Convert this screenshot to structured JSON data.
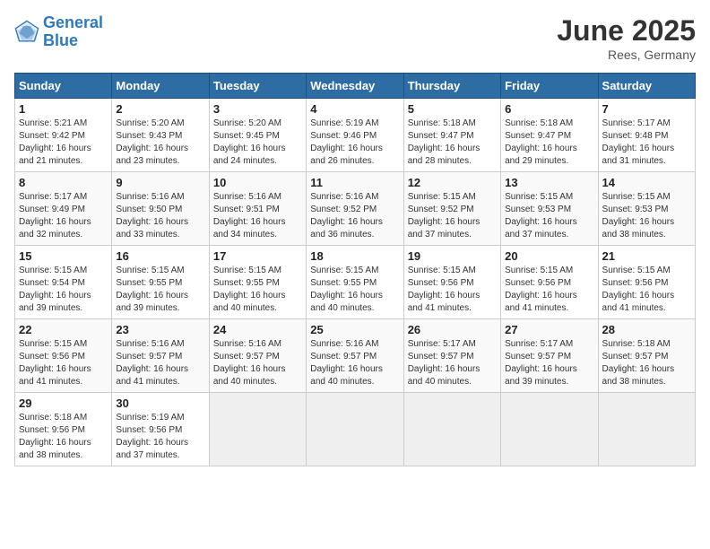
{
  "header": {
    "logo_line1": "General",
    "logo_line2": "Blue",
    "month": "June 2025",
    "location": "Rees, Germany"
  },
  "weekdays": [
    "Sunday",
    "Monday",
    "Tuesday",
    "Wednesday",
    "Thursday",
    "Friday",
    "Saturday"
  ],
  "weeks": [
    [
      {
        "day": "1",
        "sunrise": "Sunrise: 5:21 AM",
        "sunset": "Sunset: 9:42 PM",
        "daylight": "Daylight: 16 hours and 21 minutes."
      },
      {
        "day": "2",
        "sunrise": "Sunrise: 5:20 AM",
        "sunset": "Sunset: 9:43 PM",
        "daylight": "Daylight: 16 hours and 23 minutes."
      },
      {
        "day": "3",
        "sunrise": "Sunrise: 5:20 AM",
        "sunset": "Sunset: 9:45 PM",
        "daylight": "Daylight: 16 hours and 24 minutes."
      },
      {
        "day": "4",
        "sunrise": "Sunrise: 5:19 AM",
        "sunset": "Sunset: 9:46 PM",
        "daylight": "Daylight: 16 hours and 26 minutes."
      },
      {
        "day": "5",
        "sunrise": "Sunrise: 5:18 AM",
        "sunset": "Sunset: 9:47 PM",
        "daylight": "Daylight: 16 hours and 28 minutes."
      },
      {
        "day": "6",
        "sunrise": "Sunrise: 5:18 AM",
        "sunset": "Sunset: 9:47 PM",
        "daylight": "Daylight: 16 hours and 29 minutes."
      },
      {
        "day": "7",
        "sunrise": "Sunrise: 5:17 AM",
        "sunset": "Sunset: 9:48 PM",
        "daylight": "Daylight: 16 hours and 31 minutes."
      }
    ],
    [
      {
        "day": "8",
        "sunrise": "Sunrise: 5:17 AM",
        "sunset": "Sunset: 9:49 PM",
        "daylight": "Daylight: 16 hours and 32 minutes."
      },
      {
        "day": "9",
        "sunrise": "Sunrise: 5:16 AM",
        "sunset": "Sunset: 9:50 PM",
        "daylight": "Daylight: 16 hours and 33 minutes."
      },
      {
        "day": "10",
        "sunrise": "Sunrise: 5:16 AM",
        "sunset": "Sunset: 9:51 PM",
        "daylight": "Daylight: 16 hours and 34 minutes."
      },
      {
        "day": "11",
        "sunrise": "Sunrise: 5:16 AM",
        "sunset": "Sunset: 9:52 PM",
        "daylight": "Daylight: 16 hours and 36 minutes."
      },
      {
        "day": "12",
        "sunrise": "Sunrise: 5:15 AM",
        "sunset": "Sunset: 9:52 PM",
        "daylight": "Daylight: 16 hours and 37 minutes."
      },
      {
        "day": "13",
        "sunrise": "Sunrise: 5:15 AM",
        "sunset": "Sunset: 9:53 PM",
        "daylight": "Daylight: 16 hours and 37 minutes."
      },
      {
        "day": "14",
        "sunrise": "Sunrise: 5:15 AM",
        "sunset": "Sunset: 9:53 PM",
        "daylight": "Daylight: 16 hours and 38 minutes."
      }
    ],
    [
      {
        "day": "15",
        "sunrise": "Sunrise: 5:15 AM",
        "sunset": "Sunset: 9:54 PM",
        "daylight": "Daylight: 16 hours and 39 minutes."
      },
      {
        "day": "16",
        "sunrise": "Sunrise: 5:15 AM",
        "sunset": "Sunset: 9:55 PM",
        "daylight": "Daylight: 16 hours and 39 minutes."
      },
      {
        "day": "17",
        "sunrise": "Sunrise: 5:15 AM",
        "sunset": "Sunset: 9:55 PM",
        "daylight": "Daylight: 16 hours and 40 minutes."
      },
      {
        "day": "18",
        "sunrise": "Sunrise: 5:15 AM",
        "sunset": "Sunset: 9:55 PM",
        "daylight": "Daylight: 16 hours and 40 minutes."
      },
      {
        "day": "19",
        "sunrise": "Sunrise: 5:15 AM",
        "sunset": "Sunset: 9:56 PM",
        "daylight": "Daylight: 16 hours and 41 minutes."
      },
      {
        "day": "20",
        "sunrise": "Sunrise: 5:15 AM",
        "sunset": "Sunset: 9:56 PM",
        "daylight": "Daylight: 16 hours and 41 minutes."
      },
      {
        "day": "21",
        "sunrise": "Sunrise: 5:15 AM",
        "sunset": "Sunset: 9:56 PM",
        "daylight": "Daylight: 16 hours and 41 minutes."
      }
    ],
    [
      {
        "day": "22",
        "sunrise": "Sunrise: 5:15 AM",
        "sunset": "Sunset: 9:56 PM",
        "daylight": "Daylight: 16 hours and 41 minutes."
      },
      {
        "day": "23",
        "sunrise": "Sunrise: 5:16 AM",
        "sunset": "Sunset: 9:57 PM",
        "daylight": "Daylight: 16 hours and 41 minutes."
      },
      {
        "day": "24",
        "sunrise": "Sunrise: 5:16 AM",
        "sunset": "Sunset: 9:57 PM",
        "daylight": "Daylight: 16 hours and 40 minutes."
      },
      {
        "day": "25",
        "sunrise": "Sunrise: 5:16 AM",
        "sunset": "Sunset: 9:57 PM",
        "daylight": "Daylight: 16 hours and 40 minutes."
      },
      {
        "day": "26",
        "sunrise": "Sunrise: 5:17 AM",
        "sunset": "Sunset: 9:57 PM",
        "daylight": "Daylight: 16 hours and 40 minutes."
      },
      {
        "day": "27",
        "sunrise": "Sunrise: 5:17 AM",
        "sunset": "Sunset: 9:57 PM",
        "daylight": "Daylight: 16 hours and 39 minutes."
      },
      {
        "day": "28",
        "sunrise": "Sunrise: 5:18 AM",
        "sunset": "Sunset: 9:57 PM",
        "daylight": "Daylight: 16 hours and 38 minutes."
      }
    ],
    [
      {
        "day": "29",
        "sunrise": "Sunrise: 5:18 AM",
        "sunset": "Sunset: 9:56 PM",
        "daylight": "Daylight: 16 hours and 38 minutes."
      },
      {
        "day": "30",
        "sunrise": "Sunrise: 5:19 AM",
        "sunset": "Sunset: 9:56 PM",
        "daylight": "Daylight: 16 hours and 37 minutes."
      },
      null,
      null,
      null,
      null,
      null
    ]
  ]
}
